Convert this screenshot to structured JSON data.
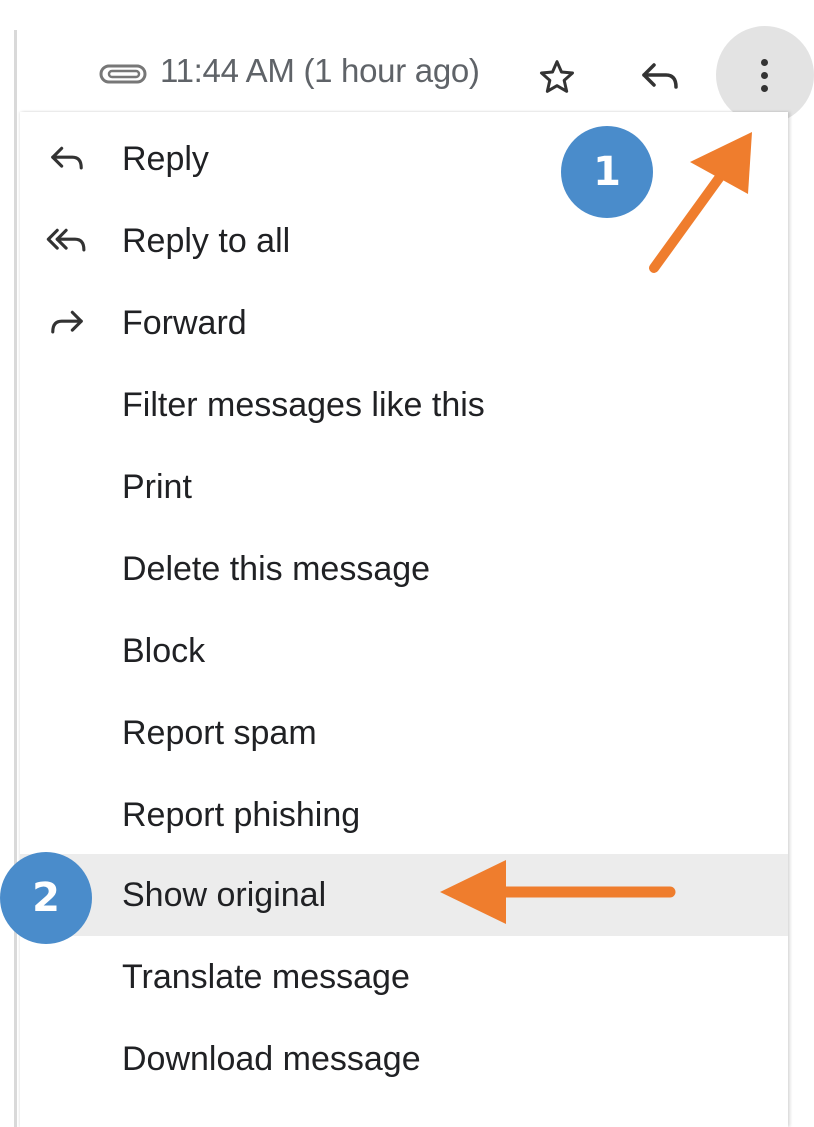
{
  "header": {
    "timestamp": "11:44 AM (1 hour ago)",
    "icons": [
      "attachment-icon",
      "star-icon",
      "reply-icon",
      "more-options-icon"
    ]
  },
  "menu": {
    "items": [
      {
        "label": "Reply",
        "icon": "reply-icon"
      },
      {
        "label": "Reply to all",
        "icon": "reply-all-icon"
      },
      {
        "label": "Forward",
        "icon": "forward-icon"
      },
      {
        "label": "Filter messages like this",
        "icon": ""
      },
      {
        "label": "Print",
        "icon": ""
      },
      {
        "label": "Delete this message",
        "icon": ""
      },
      {
        "label": "Block",
        "icon": ""
      },
      {
        "label": "Report spam",
        "icon": ""
      },
      {
        "label": "Report phishing",
        "icon": ""
      },
      {
        "label": "Show original",
        "icon": "",
        "highlighted": true
      },
      {
        "label": "Translate message",
        "icon": ""
      },
      {
        "label": "Download message",
        "icon": ""
      }
    ]
  },
  "annotations": {
    "badge_1": "1",
    "badge_2": "2",
    "accent_color": "#4a8ccb",
    "arrow_color": "#ef7d2d"
  }
}
